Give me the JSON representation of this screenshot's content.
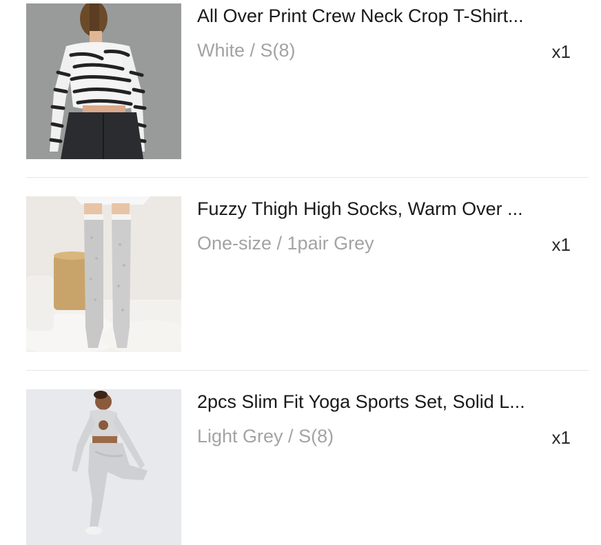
{
  "items": [
    {
      "title": "All Over Print Crew Neck Crop T-Shirt...",
      "variant": "White / S(8)",
      "quantity": "x1",
      "image_icon": "product-photo-zebra-crop-top"
    },
    {
      "title": "Fuzzy Thigh High Socks, Warm Over ...",
      "variant": "One-size / 1pair Grey",
      "quantity": "x1",
      "image_icon": "product-photo-thigh-high-socks"
    },
    {
      "title": "2pcs Slim Fit Yoga Sports Set, Solid L...",
      "variant": "Light Grey / S(8)",
      "quantity": "x1",
      "image_icon": "product-photo-yoga-set"
    }
  ]
}
